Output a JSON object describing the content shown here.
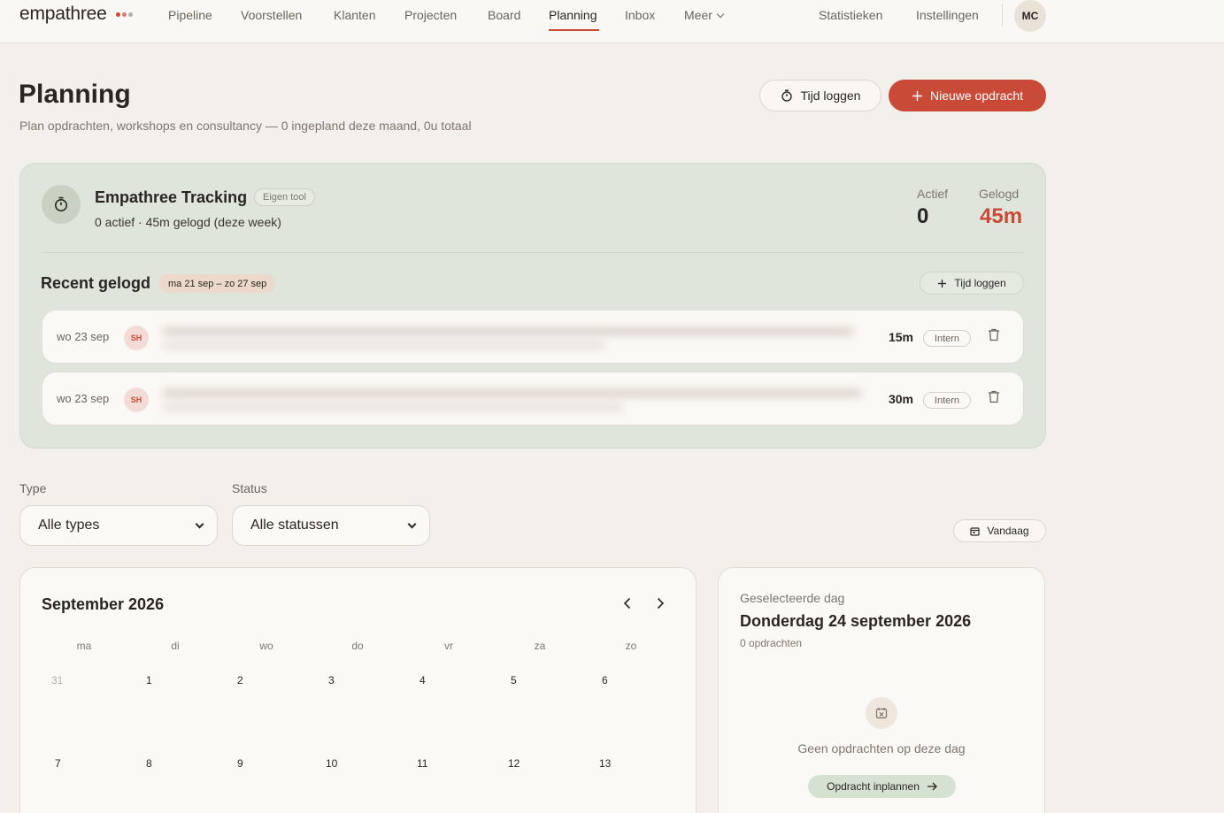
{
  "brand": {
    "logo_text": "empathree",
    "dot_colors": [
      "#c94a36",
      "#d97b6a",
      "#b5aea6"
    ],
    "accent": "#c94a36"
  },
  "nav": {
    "items": [
      {
        "label": "Pipeline"
      },
      {
        "label": "Voorstellen"
      },
      {
        "label": "Klanten"
      },
      {
        "label": "Projecten"
      },
      {
        "label": "Board"
      },
      {
        "label": "Planning",
        "active": true
      },
      {
        "label": "Inbox"
      },
      {
        "label": "Meer"
      }
    ],
    "right": [
      {
        "label": "Statistieken"
      },
      {
        "label": "Instellingen"
      }
    ],
    "avatar_initials": "MC"
  },
  "header": {
    "title": "Planning",
    "subtitle": "Plan opdrachten, workshops en consultancy — 0 ingepland deze maand, 0u totaal",
    "log_time_label": "Tijd loggen",
    "new_assignment_label": "Nieuwe opdracht"
  },
  "tracking": {
    "title": "Empathree Tracking",
    "badge": "Eigen tool",
    "summary": "0 actief · 45m gelogd (deze week)",
    "active_label": "Actief",
    "active_value": "0",
    "logged_label": "Gelogd",
    "logged_value": "45m",
    "recent_title": "Recent gelogd",
    "range_badge": "ma 21 sep – zo 27 sep",
    "log_time_label": "Tijd loggen",
    "entries": [
      {
        "date": "wo 23 sep",
        "initials": "SH",
        "duration": "15m",
        "tag": "Intern"
      },
      {
        "date": "wo 23 sep",
        "initials": "SH",
        "duration": "30m",
        "tag": "Intern"
      }
    ]
  },
  "filters": {
    "type_label": "Type",
    "type_value": "Alle types",
    "status_label": "Status",
    "status_value": "Alle statussen",
    "today_label": "Vandaag"
  },
  "calendar": {
    "title": "September 2026",
    "weekdays": [
      "ma",
      "di",
      "wo",
      "do",
      "vr",
      "za",
      "zo"
    ],
    "rows": [
      [
        "31",
        "1",
        "2",
        "3",
        "4",
        "5",
        "6"
      ],
      [
        "7",
        "8",
        "9",
        "10",
        "11",
        "12",
        "13"
      ]
    ],
    "muted_days": [
      "31"
    ]
  },
  "selected_day": {
    "label": "Geselecteerde dag",
    "title": "Donderdag 24 september 2026",
    "count": "0 opdrachten",
    "empty_text": "Geen opdrachten op deze dag",
    "plan_label": "Opdracht inplannen"
  }
}
